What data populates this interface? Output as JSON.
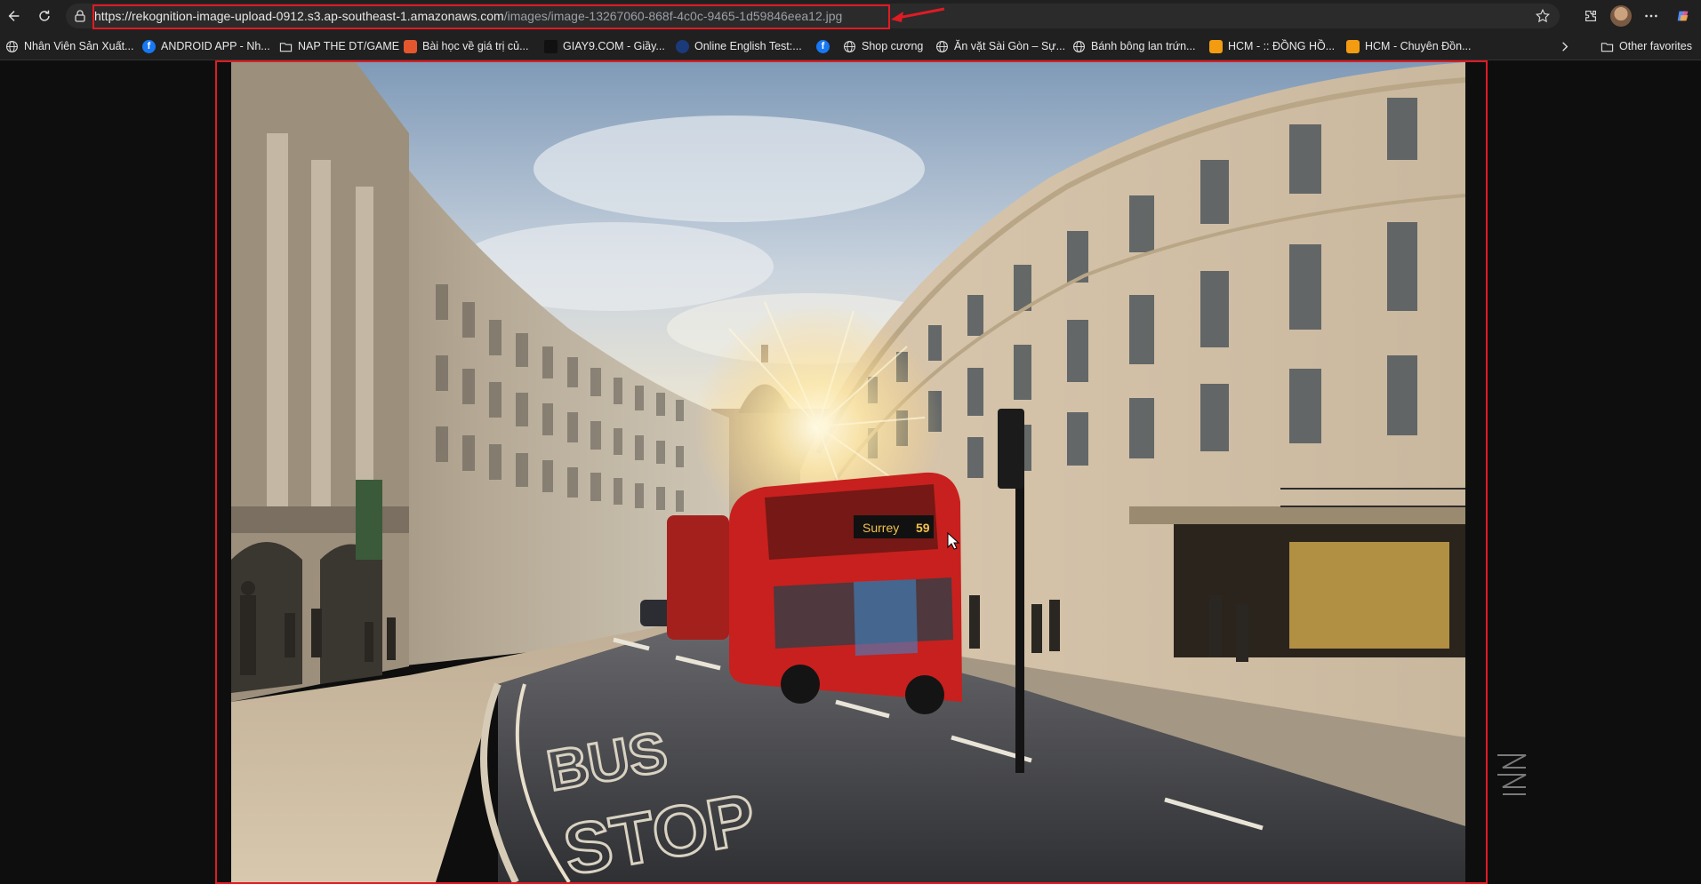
{
  "browser": {
    "url_host": "https://rekognition-image-upload-0912.s3.ap-southeast-1.amazonaws.com",
    "url_path": "/images/image-13267060-868f-4c0c-9465-1d59846eea12.jpg"
  },
  "bookmarks": [
    {
      "label": "Nhân Viên Sản Xuất...",
      "icon": "globe-icon"
    },
    {
      "label": "ANDROID APP - Nh...",
      "icon": "facebook-icon"
    },
    {
      "label": "NAP THE DT/GAME",
      "icon": "folder-icon"
    },
    {
      "label": "Bài học về giá trị củ...",
      "icon": "site-icon"
    },
    {
      "label": "GIAY9.COM - Giầy...",
      "icon": "site-icon"
    },
    {
      "label": "Online English Test:...",
      "icon": "site-icon"
    },
    {
      "label": "Shop cương",
      "icon": "globe-icon"
    },
    {
      "label": "Ăn vặt Sài Gòn – Sự...",
      "icon": "globe-icon"
    },
    {
      "label": "Bánh bông lan trứn...",
      "icon": "globe-icon"
    },
    {
      "label": "HCM - :: ĐỒNG HỒ...",
      "icon": "site-icon"
    },
    {
      "label": "HCM - Chuyên Đồn...",
      "icon": "site-icon"
    }
  ],
  "other_favorites": "Other favorites",
  "photo": {
    "bus_destination": "Surrey",
    "bus_number": "59",
    "road_marking_1": "BUS",
    "road_marking_2": "STOP"
  },
  "colors": {
    "highlight": "#e01b24",
    "bus_red": "#c8201e",
    "toolbar_bg": "#202020"
  }
}
